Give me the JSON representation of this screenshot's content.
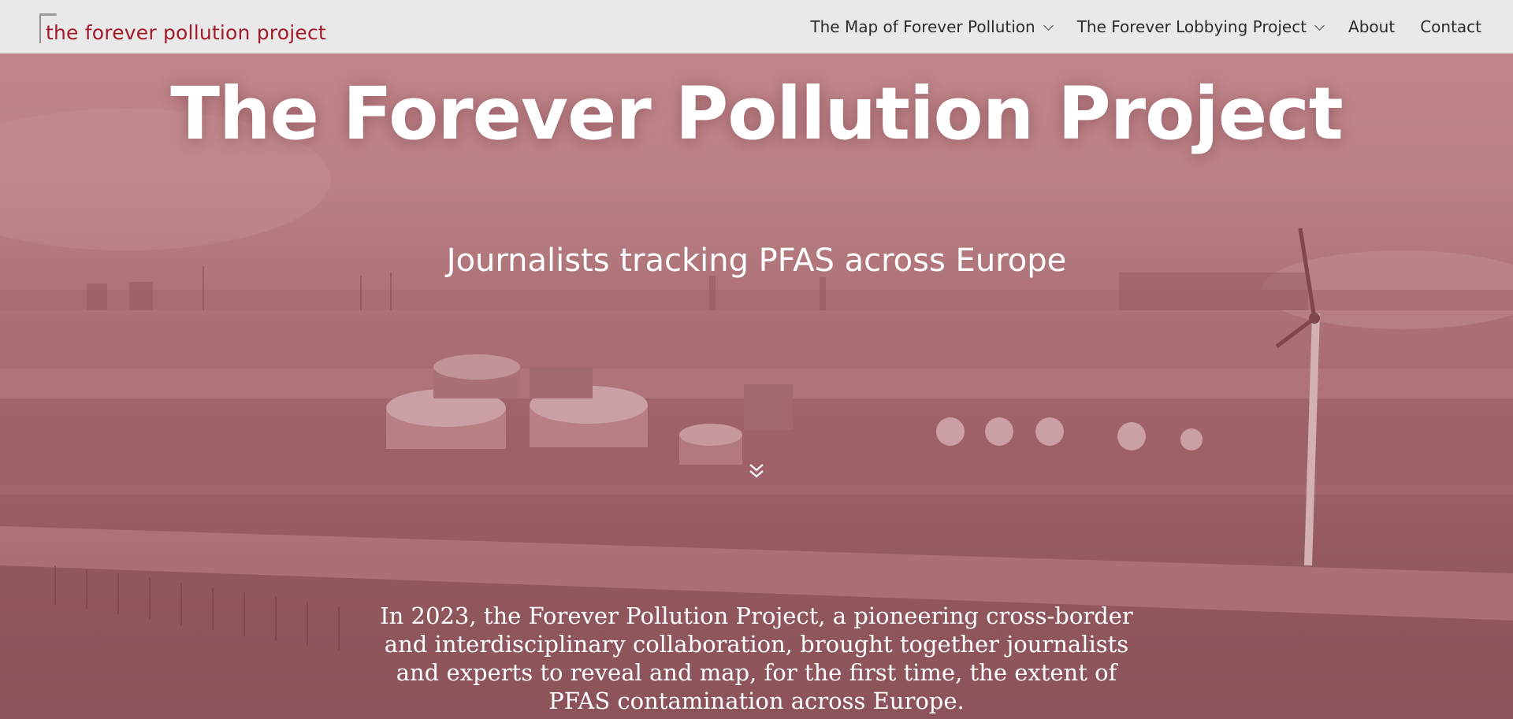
{
  "header": {
    "logo_text": "the forever pollution project",
    "nav": [
      {
        "label": "The Map of Forever Pollution",
        "has_dropdown": true
      },
      {
        "label": "The Forever Lobbying Project",
        "has_dropdown": true
      },
      {
        "label": "About",
        "has_dropdown": false
      },
      {
        "label": "Contact",
        "has_dropdown": false
      }
    ]
  },
  "hero": {
    "title": "The Forever Pollution Project",
    "subtitle": "Journalists tracking PFAS across Europe",
    "scroll_icon": "double-chevron-down-icon",
    "intro": "In 2023, the Forever Pollution Project, a pioneering cross-border and interdisciplinary collaboration, brought together journalists and experts to reveal and map, for the first time, the extent of PFAS contamination across Europe."
  },
  "colors": {
    "brand_red": "#a31a2a",
    "header_bg": "#e9e9e9",
    "hero_tint": "#a96d73",
    "text_white": "#ffffff"
  }
}
